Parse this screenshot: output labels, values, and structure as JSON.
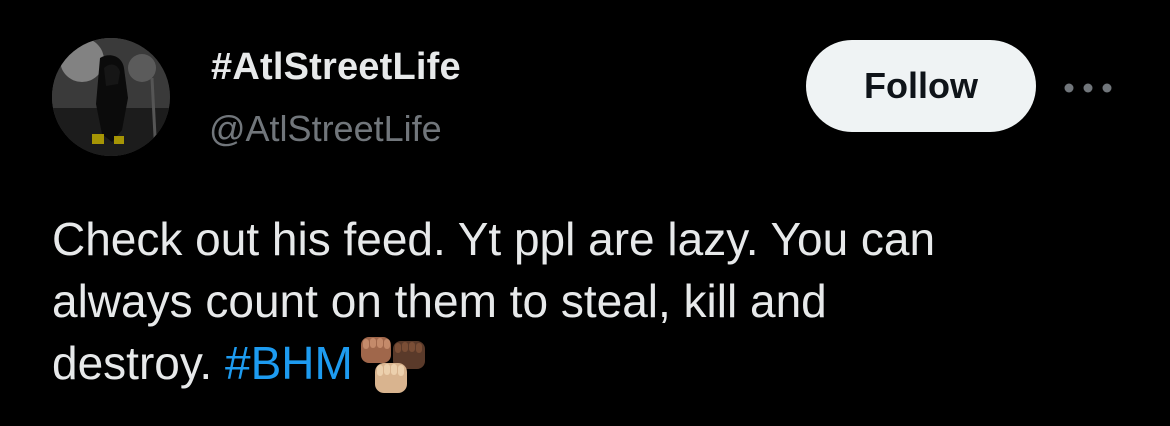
{
  "author": {
    "display_name": "#AtlStreetLife",
    "handle": "@AtlStreetLife",
    "avatar_icon": "avatar-photo"
  },
  "actions": {
    "follow_label": "Follow",
    "more_icon": "more-horizontal-icon"
  },
  "tweet": {
    "text_line_1": "Check out his feed. Yt ppl are lazy. You can",
    "text_line_2": "always count on them to steal, kill and",
    "text_line_3_prefix": "destroy. ",
    "hashtag": "#BHM",
    "emoji": "raised-fist-emojis"
  },
  "colors": {
    "background": "#000000",
    "text_primary": "#e7e9ea",
    "text_secondary": "#71767b",
    "link": "#1d9bf0",
    "follow_bg": "#eff3f4",
    "follow_text": "#0f1419"
  }
}
